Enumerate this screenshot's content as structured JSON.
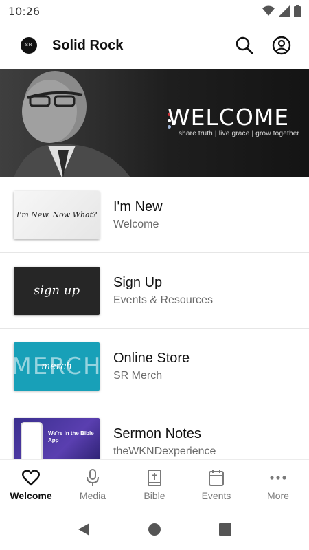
{
  "status_bar": {
    "time": "10:26"
  },
  "app_bar": {
    "logo_text": "SR",
    "title": "Solid Rock"
  },
  "hero": {
    "title": "WELCOME",
    "subtitle": "share truth | live grace | grow together"
  },
  "list": {
    "items": [
      {
        "title": "I'm New",
        "subtitle": "Welcome",
        "thumb_text": "I'm New. Now What?"
      },
      {
        "title": "Sign Up",
        "subtitle": "Events & Resources",
        "thumb_text": "sign up"
      },
      {
        "title": "Online Store",
        "subtitle": "SR Merch",
        "thumb_big": "MERCH",
        "thumb_text": "merch"
      },
      {
        "title": "Sermon Notes",
        "subtitle": "theWKNDexperience",
        "thumb_text": "We're in the Bible App"
      }
    ]
  },
  "bottom_nav": {
    "items": [
      {
        "label": "Welcome",
        "icon": "heart-icon",
        "active": true
      },
      {
        "label": "Media",
        "icon": "microphone-icon"
      },
      {
        "label": "Bible",
        "icon": "bible-icon"
      },
      {
        "label": "Events",
        "icon": "calendar-icon"
      },
      {
        "label": "More",
        "icon": "more-dots-icon"
      }
    ]
  },
  "colors": {
    "accent_dot_red": "#d0343b",
    "accent_dot_blue": "#9fb4d6",
    "merch_teal": "#18a0b8"
  }
}
